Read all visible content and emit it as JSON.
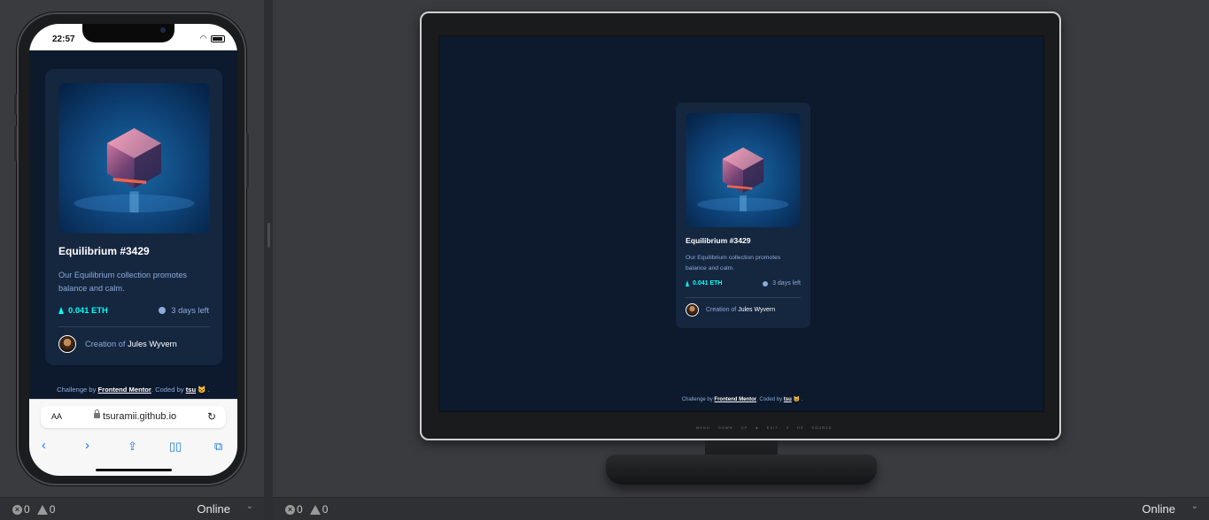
{
  "colors": {
    "page_bg": "#0d192c",
    "card_bg": "#15263f",
    "accent_cyan": "#00fff8",
    "soft_blue": "#8bacd9",
    "white": "#ffffff"
  },
  "phone": {
    "status_time": "22:57",
    "browser": {
      "text_size_label": "AA",
      "url": "tsuramii.github.io",
      "reload_icon": "reload-icon",
      "nav_icons": [
        "back-icon",
        "forward-icon",
        "share-icon",
        "bookmarks-icon",
        "tabs-icon"
      ]
    }
  },
  "nft_card": {
    "title": "Equilibrium #3429",
    "description": "Our Equilibrium collection promotes balance and calm.",
    "price": "0.041 ETH",
    "time_left": "3 days left",
    "creation_prefix": "Creation of",
    "creator": "Jules Wyvern"
  },
  "attribution": {
    "prefix": "Challenge by",
    "challenge_link": "Frontend Mentor",
    "middle": ". Coded by",
    "coder_link": "tsu",
    "suffix": "🐱 ."
  },
  "monitor": {
    "osd_buttons": "MENU DOWN UP ● EXIT 3 HZ SOURCE"
  },
  "status_bar": {
    "errors": "0",
    "warnings": "0",
    "network": "Online"
  }
}
